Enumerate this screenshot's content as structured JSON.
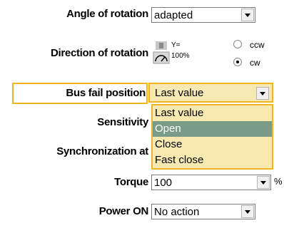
{
  "rows": {
    "angle": {
      "label": "Angle of rotation",
      "value": "adapted"
    },
    "direction": {
      "label": "Direction of rotation",
      "icon_text_line1": "Y=",
      "icon_text_line2": "100%",
      "ccw_label": "ccw",
      "cw_label": "cw",
      "selected": "cw"
    },
    "bus_fail": {
      "label": "Bus fail position",
      "value": "Last value",
      "options": [
        "Last value",
        "Open",
        "Close",
        "Fast close"
      ],
      "highlighted_option": "Open"
    },
    "sensitivity": {
      "label": "Sensitivity"
    },
    "sync": {
      "label": "Synchronization at"
    },
    "torque": {
      "label": "Torque",
      "value": "100",
      "unit": "%"
    },
    "power_on": {
      "label": "Power ON",
      "value": "No action"
    }
  },
  "colors": {
    "highlight": "#f2b41f",
    "dropdown_bg": "#f8e9b0",
    "selected_option_bg": "#7a9b86"
  }
}
